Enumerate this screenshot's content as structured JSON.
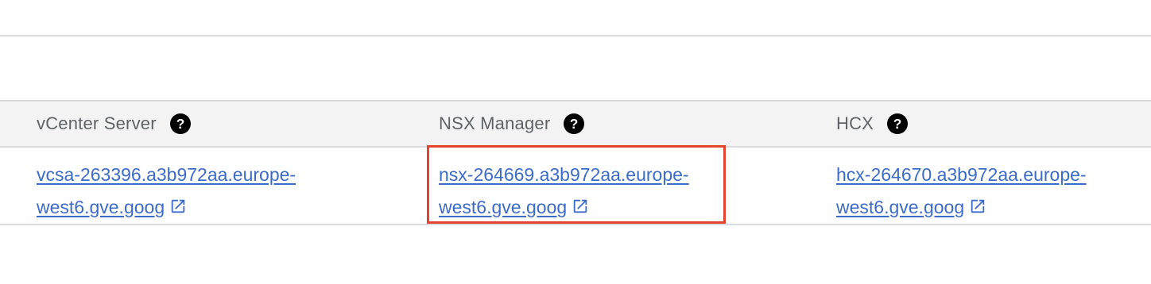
{
  "table": {
    "headers": [
      {
        "label": "vCenter Server",
        "help_icon": "help-circle-icon"
      },
      {
        "label": "NSX Manager",
        "help_icon": "help-circle-icon"
      },
      {
        "label": "HCX",
        "help_icon": "help-circle-icon"
      }
    ],
    "row": [
      {
        "line1": "vcsa-263396.a3b972aa.europe-",
        "line2": "west6.gve.goog",
        "icon": "external-link-icon"
      },
      {
        "line1": "nsx-264669.a3b972aa.europe-",
        "line2": "west6.gve.goog",
        "icon": "external-link-icon"
      },
      {
        "line1": "hcx-264670.a3b972aa.europe-",
        "line2": "west6.gve.goog",
        "icon": "external-link-icon"
      }
    ]
  },
  "colors": {
    "link": "#3c6cc9",
    "header_bg": "#f3f3f3",
    "header_text": "#5f6368",
    "divider": "#dadce0",
    "highlight": "#e5432e"
  }
}
